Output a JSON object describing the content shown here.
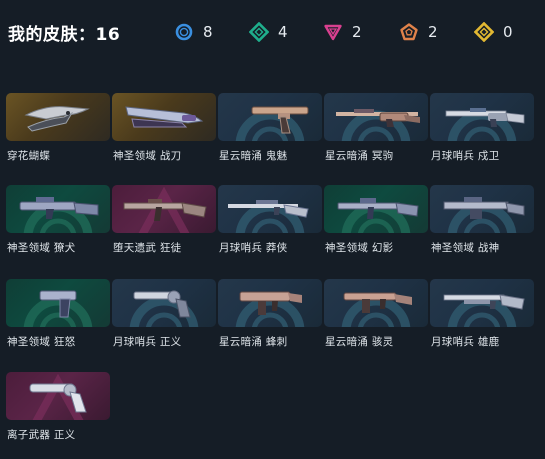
{
  "header": {
    "title": "我的皮肤：16",
    "tiers": [
      {
        "icon": "select-tier-icon",
        "color": "#3a8fe0",
        "count": "8"
      },
      {
        "icon": "deluxe-tier-icon",
        "color": "#1fae8c",
        "count": "4"
      },
      {
        "icon": "premium-tier-icon",
        "color": "#d8408f",
        "count": "2"
      },
      {
        "icon": "exclusive-tier-icon",
        "color": "#e0824a",
        "count": "2"
      },
      {
        "icon": "ultra-tier-icon",
        "color": "#e2b832",
        "count": "0"
      }
    ]
  },
  "skins": [
    {
      "name": "穿花蝴蝶",
      "tier": "select",
      "weapon": "butterfly-knife-icon"
    },
    {
      "name": "神圣领域 战刀",
      "tier": "select",
      "weapon": "blade-icon"
    },
    {
      "name": "星云暗涌 鬼魅",
      "tier": "blue",
      "weapon": "ghost-pistol-icon"
    },
    {
      "name": "星云暗涌 冥驹",
      "tier": "blue",
      "weapon": "marshal-rifle-icon"
    },
    {
      "name": "月球哨兵 戍卫",
      "tier": "blue",
      "weapon": "guardian-rifle-icon"
    },
    {
      "name": "神圣领域 獠犬",
      "tier": "deluxe",
      "weapon": "bulldog-rifle-icon"
    },
    {
      "name": "堕天遗武 狂徒",
      "tier": "premium",
      "weapon": "vandal-rifle-icon"
    },
    {
      "name": "月球哨兵 莽侠",
      "tier": "blue",
      "weapon": "outlaw-rifle-icon"
    },
    {
      "name": "神圣领域 幻影",
      "tier": "deluxe",
      "weapon": "phantom-rifle-icon"
    },
    {
      "name": "神圣领域 战神",
      "tier": "blue",
      "weapon": "ares-lmg-icon"
    },
    {
      "name": "神圣领域 狂怒",
      "tier": "deluxe",
      "weapon": "frenzy-pistol-icon"
    },
    {
      "name": "月球哨兵 正义",
      "tier": "blue",
      "weapon": "sheriff-revolver-icon"
    },
    {
      "name": "星云暗涌 蜂刺",
      "tier": "blue",
      "weapon": "stinger-smg-icon"
    },
    {
      "name": "星云暗涌 骇灵",
      "tier": "blue",
      "weapon": "spectre-smg-icon"
    },
    {
      "name": "月球哨兵 雄鹿",
      "tier": "blue",
      "weapon": "bucky-shotgun-icon"
    },
    {
      "name": "离子武器 正义",
      "tier": "premium",
      "weapon": "ion-sheriff-icon"
    }
  ]
}
